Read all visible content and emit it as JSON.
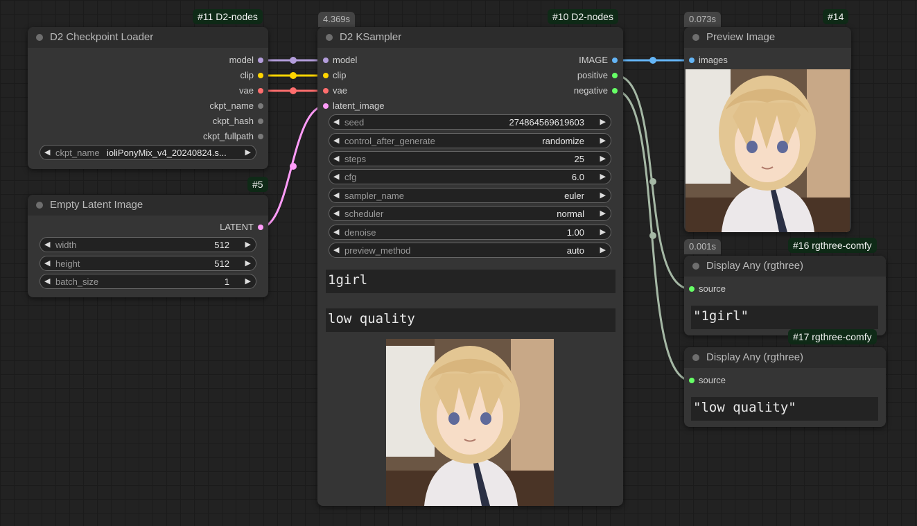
{
  "colors": {
    "model": "#b39ddb",
    "clip": "#ffd500",
    "vae": "#ff6e6e",
    "latent": "#ff9cf9",
    "image": "#64b5f6",
    "conditioning": "#66ff66",
    "socket_idle": "#7a7a7a",
    "badge_bg": "#0f2a17",
    "wire_conditioning": "#a5b8a5"
  },
  "checkpoint_loader": {
    "badge": "#11 D2-nodes",
    "title": "D2 Checkpoint Loader",
    "outputs": [
      "model",
      "clip",
      "vae",
      "ckpt_name",
      "ckpt_hash",
      "ckpt_fullpath"
    ],
    "ckpt_name_label": "ckpt_name",
    "ckpt_name_value": "ioliPonyMix_v4_20240824.s..."
  },
  "empty_latent": {
    "badge": "#5",
    "title": "Empty Latent Image",
    "output": "LATENT",
    "widgets": [
      {
        "label": "width",
        "value": "512"
      },
      {
        "label": "height",
        "value": "512"
      },
      {
        "label": "batch_size",
        "value": "1"
      }
    ]
  },
  "ksampler": {
    "timing": "4.369s",
    "badge": "#10 D2-nodes",
    "title": "D2 KSampler",
    "inputs": [
      "model",
      "clip",
      "vae",
      "latent_image"
    ],
    "outputs": [
      "IMAGE",
      "positive",
      "negative"
    ],
    "widgets": [
      {
        "label": "seed",
        "value": "274864569619603"
      },
      {
        "label": "control_after_generate",
        "value": "randomize"
      },
      {
        "label": "steps",
        "value": "25"
      },
      {
        "label": "cfg",
        "value": "6.0"
      },
      {
        "label": "sampler_name",
        "value": "euler"
      },
      {
        "label": "scheduler",
        "value": "normal"
      },
      {
        "label": "denoise",
        "value": "1.00"
      },
      {
        "label": "preview_method",
        "value": "auto"
      }
    ],
    "positive_prompt": "1girl",
    "negative_prompt": "low quality"
  },
  "preview_image": {
    "timing": "0.073s",
    "badge": "#14",
    "title": "Preview Image",
    "input": "images"
  },
  "display_positive": {
    "timing": "0.001s",
    "badge": "#16 rgthree-comfy",
    "title": "Display Any (rgthree)",
    "input": "source",
    "value": "\"1girl\""
  },
  "display_negative": {
    "badge": "#17 rgthree-comfy",
    "title": "Display Any (rgthree)",
    "input": "source",
    "value": "\"low quality\""
  },
  "icons": {
    "collapse": "node-collapse-dot-icon",
    "decrement": "arrow-left-icon",
    "increment": "arrow-right-icon",
    "socket": "socket-dot-icon",
    "reroute": "reroute-dot-icon"
  }
}
